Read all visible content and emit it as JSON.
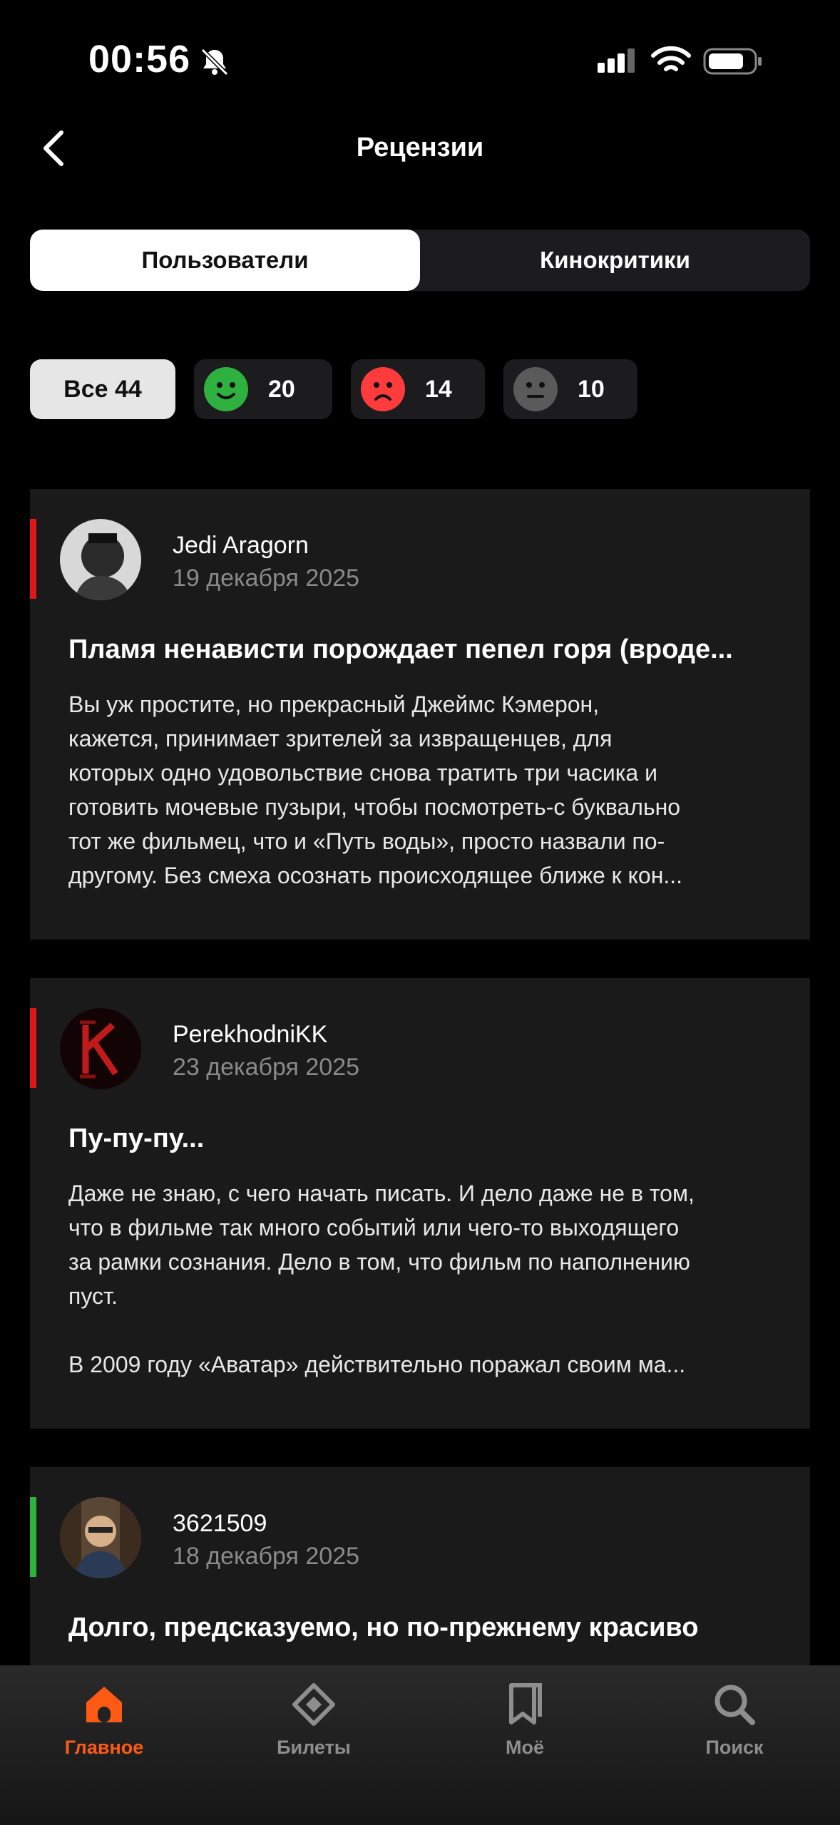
{
  "status_bar": {
    "time": "00:56"
  },
  "header": {
    "title": "Рецензии"
  },
  "segments": {
    "users": "Пользователи",
    "critics": "Кинокритики"
  },
  "filters": {
    "all": "Все 44",
    "positive": "20",
    "negative": "14",
    "neutral": "10"
  },
  "colors": {
    "positive": "#2fb140",
    "negative": "#ff3b3b",
    "neutral": "#5a5a5a",
    "accent": "#ff5a13"
  },
  "reviews": [
    {
      "author": "Jedi Aragorn",
      "date": "19 декабря 2025",
      "sentiment": "negative",
      "title": "Пламя ненависти порождает пепел горя (вроде...",
      "text": "Вы уж простите, но прекрасный Джеймс Кэмерон,\nкажется, принимает зрителей за извращенцев, для\nкоторых одно удовольствие снова тратить три часика и\nготовить мочевые пузыри, чтобы посмотреть-с буквально\nтот же фильмец, что и «Путь воды», просто назвали по-\nдругому. Без смеха осознать происходящее ближе к кон..."
    },
    {
      "author": "PerekhodniKK",
      "date": "23 декабря 2025",
      "sentiment": "negative",
      "title": "Пу-пу-пу...",
      "text": "Даже не знаю, с чего начать писать. И дело даже не в том,\nчто в фильме так много событий или чего-то выходящего\nза рамки сознания. Дело в том, что фильм по наполнению\nпуст.\n\nВ 2009 году «Аватар» действительно поражал своим ма..."
    },
    {
      "author": "3621509",
      "date": "18 декабря 2025",
      "sentiment": "positive",
      "title": "Долго, предсказуемо, но по-прежнему красиво",
      "text": ""
    }
  ],
  "tabbar": {
    "home": "Главное",
    "tickets": "Билеты",
    "mine": "Моё",
    "search": "Поиск"
  }
}
